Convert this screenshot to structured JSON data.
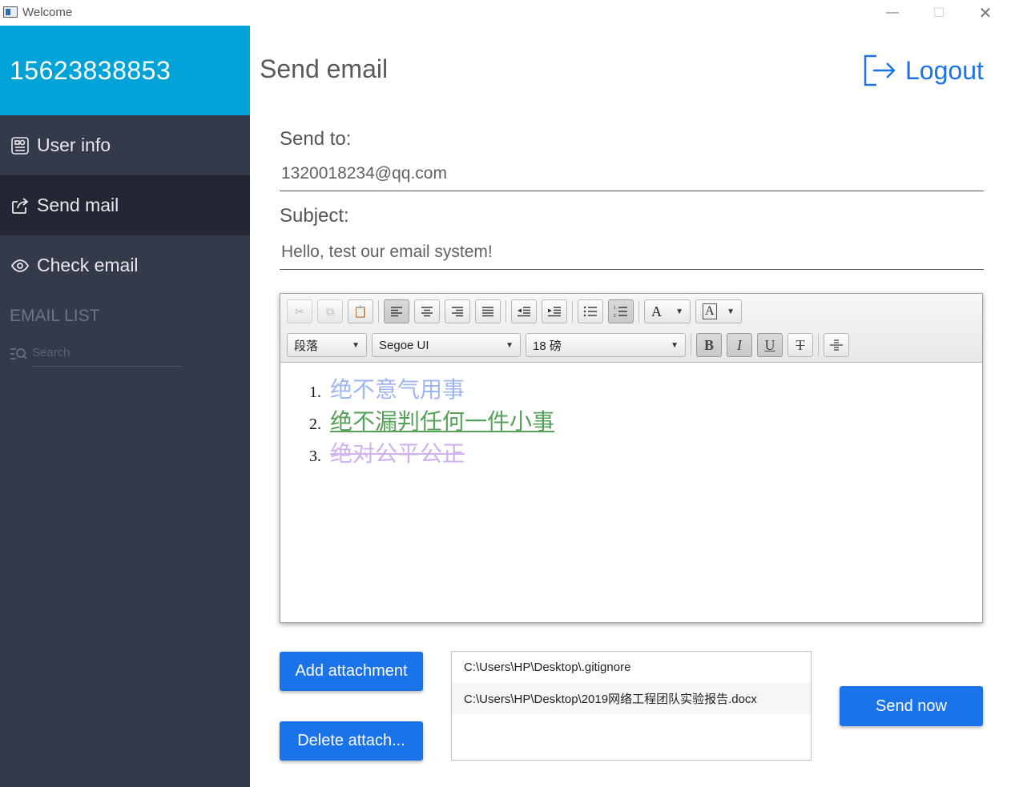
{
  "window": {
    "title": "Welcome",
    "minimize": "—",
    "maximize": "☐",
    "close": "✕"
  },
  "sidebar": {
    "account": "15623838853",
    "items": [
      {
        "label": "User info",
        "icon": "id-card-icon"
      },
      {
        "label": "Send mail",
        "icon": "share-icon"
      },
      {
        "label": "Check email",
        "icon": "eye-icon"
      }
    ],
    "active_item": "Send mail",
    "list_header": "EMAIL LIST",
    "search_placeholder": "Search"
  },
  "header": {
    "title": "Send email",
    "logout_label": "Logout"
  },
  "form": {
    "to_label": "Send to:",
    "to_value": "1320018234@qq.com",
    "subject_label": "Subject:",
    "subject_value": "Hello, test our email system!"
  },
  "editor": {
    "paragraph_style": "段落",
    "font_family": "Segoe UI",
    "font_size": "18 磅",
    "content": [
      {
        "num": "1.",
        "text": "绝不意气用事"
      },
      {
        "num": "2.",
        "text": "绝不漏判任何一件小事"
      },
      {
        "num": "3.",
        "text": "绝对公平公正"
      }
    ]
  },
  "attachments": {
    "add_label": "Add attachment",
    "delete_label": "Delete attach...",
    "files": [
      "C:\\Users\\HP\\Desktop\\.gitignore",
      "C:\\Users\\HP\\Desktop\\2019网络工程团队实验报告.docx"
    ]
  },
  "send_label": "Send now",
  "colors": {
    "accent": "#1a73e8",
    "sidebar": "#353a4a",
    "sidebar_active": "#232734",
    "account_bar": "#00a3d8"
  }
}
